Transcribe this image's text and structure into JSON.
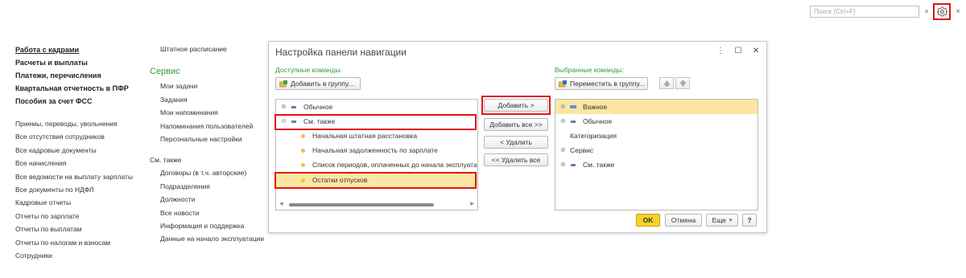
{
  "topbar": {
    "search_placeholder": "Поиск (Ctrl+F)",
    "search_clear": "×",
    "close": "×"
  },
  "left_nav": {
    "sections": [
      {
        "label": "Работа с кадрами",
        "current": true
      },
      {
        "label": "Расчеты и выплаты",
        "current": false
      },
      {
        "label": "Платежи, перечисления",
        "current": false
      },
      {
        "label": "Квартальная отчетность в ПФР",
        "current": false
      },
      {
        "label": "Пособия за счет ФСС",
        "current": false
      }
    ],
    "links": [
      "Приемы, переводы, увольнения",
      "Все отсутствия сотрудников",
      "Все кадровые документы",
      "Все начисления",
      "Все ведомости на выплату зарплаты",
      "Все документы по НДФЛ",
      "Кадровые отчеты",
      "Отчеты по зарплате",
      "Отчеты по выплатам",
      "Отчеты по налогам и взносам",
      "Сотрудники"
    ]
  },
  "mid_nav": {
    "top_item": "Штатное расписание",
    "service_title": "Сервис",
    "service_items": [
      "Мои задачи",
      "Задания",
      "Мои напоминания",
      "Напоминания пользователей",
      "Персональные настройки"
    ],
    "see_also_title": "См. также",
    "see_also_items": [
      "Договоры (в т.ч. авторские)",
      "Подразделения",
      "Должности",
      "Все новости",
      "Информация и поддержка",
      "Данные на начало эксплуатации"
    ]
  },
  "dialog": {
    "title": "Настройка панели навигации",
    "controls": {
      "more": "⋮",
      "maximize": "☐",
      "close": "✕"
    },
    "available_label": "Доступные команды:",
    "selected_label": "Выбранные команды:",
    "add_to_group": "Добавить в группу...",
    "move_to_group": "Переместить в группу...",
    "left_tree": [
      {
        "label": "Обычное",
        "kind": "group",
        "expander": "⊕"
      },
      {
        "label": "См. также",
        "kind": "group",
        "expander": "⊖"
      },
      {
        "label": "Начальная штатная расстановка",
        "kind": "item"
      },
      {
        "label": "Начальная задолженность по зарплате",
        "kind": "item"
      },
      {
        "label": "Список периодов, оплаченных до начала эксплуатац...",
        "kind": "item"
      },
      {
        "label": "Остатки отпусков",
        "kind": "item",
        "selected": true
      }
    ],
    "buttons": {
      "add": "Добавить >",
      "add_all": "Добавить все >>",
      "remove": "< Удалить",
      "remove_all": "<< Удалить все"
    },
    "right_tree": [
      {
        "label": "Важное",
        "kind": "group",
        "expander": "⊕",
        "selected": true
      },
      {
        "label": "Обычное",
        "kind": "group",
        "expander": "⊕"
      },
      {
        "label": "Категоризация",
        "kind": "plain"
      },
      {
        "label": "Сервис",
        "kind": "plain",
        "expander": "⊕"
      },
      {
        "label": "См. также",
        "kind": "group",
        "expander": "⊕"
      }
    ],
    "footer": {
      "ok": "OK",
      "cancel": "Отмена",
      "more": "Еще",
      "help": "?"
    }
  },
  "colors": {
    "accent_green": "#2f9d3a",
    "highlight_red": "#e21313",
    "selection_yellow": "#fbe7a3",
    "ok_yellow": "#f7d22a"
  },
  "icons": [
    "gear-icon",
    "add-to-group-icon",
    "move-to-group-icon",
    "arrow-up-icon",
    "arrow-down-icon",
    "folder-icon",
    "bullet-icon"
  ]
}
